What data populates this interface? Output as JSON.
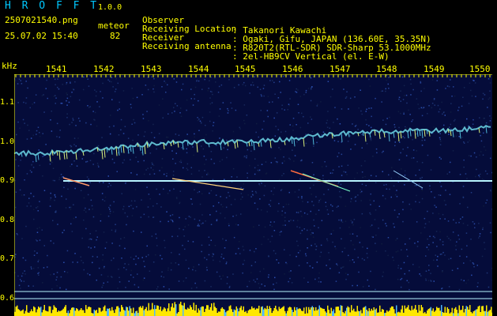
{
  "header": {
    "app_title": "H R O F F T",
    "app_version": "1.0.0",
    "file_name": "2507021540.png",
    "mode_label": "meteor",
    "date_time": "25.07.02 15:40",
    "count": "82"
  },
  "info": [
    {
      "label": "Observer",
      "value": ": Takanori Kawachi"
    },
    {
      "label": "Receiving Location",
      "value": ": Ogaki, Gifu, JAPAN (136.60E, 35.35N)"
    },
    {
      "label": "Receiver",
      "value": ": R820T2(RTL-SDR) SDR-Sharp 53.1000MHz"
    },
    {
      "label": "Receiving antenna",
      "value": ": 2el-HB9CV Vertical (el. E-W)"
    }
  ],
  "axis": {
    "y_unit": "kHz",
    "y_ticks": [
      "1.1",
      "1.0",
      "0.9",
      "0.8",
      "0.7",
      "0.6"
    ],
    "x_ticks": [
      "1541",
      "1542",
      "1543",
      "1544",
      "1545",
      "1546",
      "1547",
      "1548",
      "1549",
      "1550"
    ]
  },
  "colors": {
    "text": "#ffff00",
    "title": "#00c8ff",
    "background": "#000000",
    "noise": "#0a1a6e",
    "carrier": "#b8f4ff",
    "echo": "#ff6a3d",
    "power_bar": "#ffe800"
  }
}
